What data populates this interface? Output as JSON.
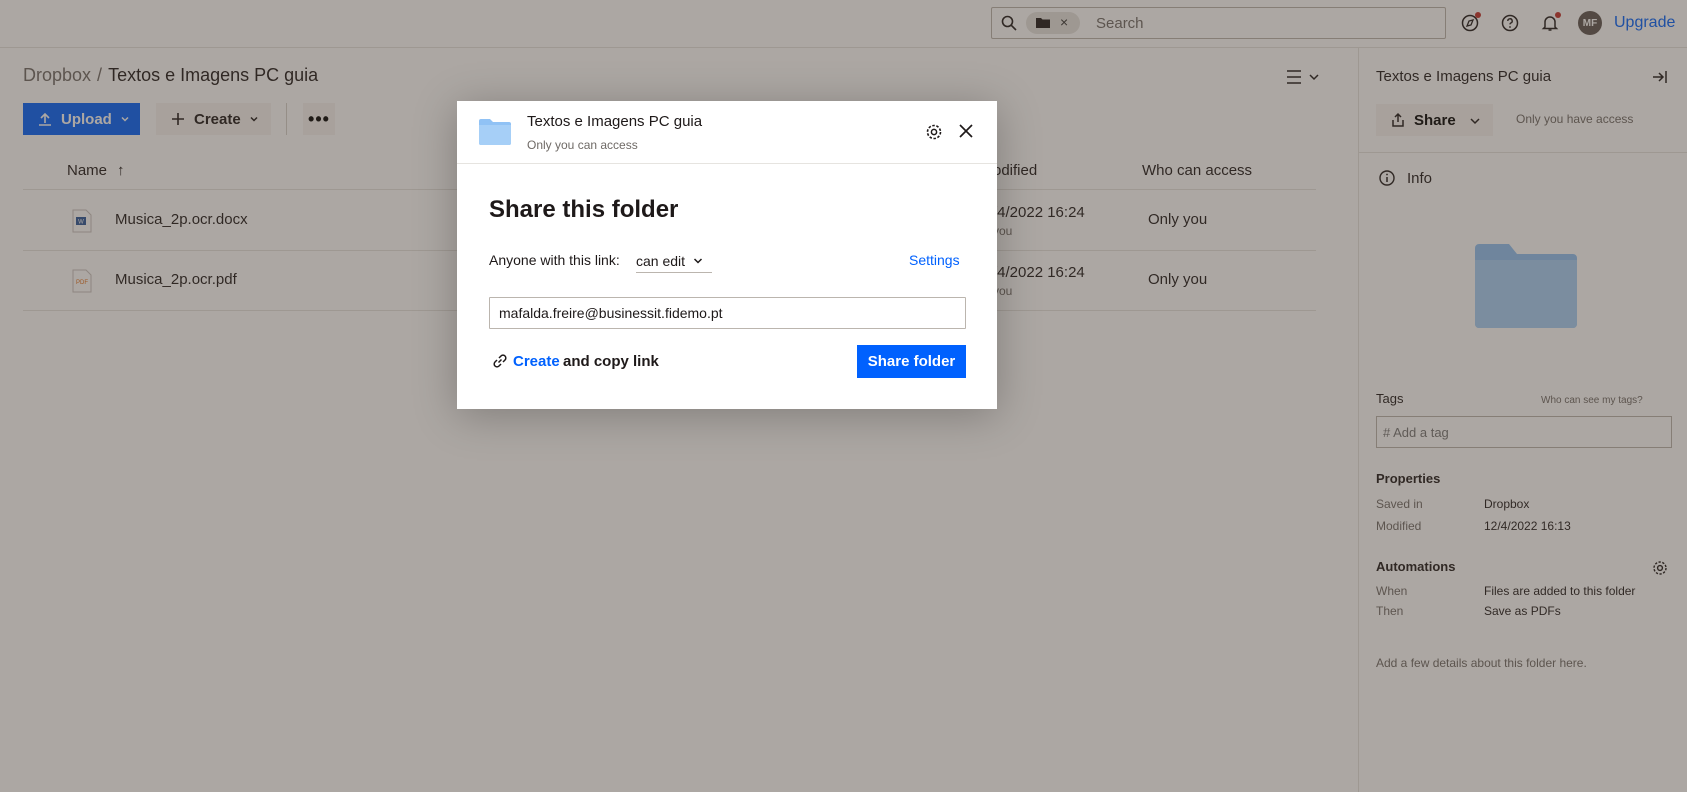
{
  "topbar": {
    "search_placeholder": "Search",
    "chip_close": "×",
    "avatar_initials": "MF",
    "upgrade_label": "Upgrade"
  },
  "breadcrumb": {
    "root": "Dropbox",
    "separator": "/",
    "current": "Textos e Imagens PC guia"
  },
  "toolbar": {
    "upload_label": "Upload",
    "create_label": "Create",
    "more_label": "•••"
  },
  "table": {
    "columns": {
      "name": "Name",
      "sort_arrow": "↑",
      "modified": "odified",
      "access": "Who can access"
    },
    "rows": [
      {
        "name": "Musica_2p.ocr.docx",
        "modified": "/4/2022 16:24",
        "by": "you",
        "access": "Only you",
        "file_type": "word"
      },
      {
        "name": "Musica_2p.ocr.pdf",
        "modified": "/4/2022 16:24",
        "by": "you",
        "access": "Only you",
        "file_type": "pdf"
      }
    ]
  },
  "right_panel": {
    "title": "Textos e Imagens PC guia",
    "share_label": "Share",
    "access_text": "Only you have access",
    "info_label": "Info",
    "tags_label": "Tags",
    "tags_help": "Who can see my tags?",
    "tag_placeholder": "# Add a tag",
    "properties_label": "Properties",
    "saved_in_label": "Saved in",
    "saved_in_value": "Dropbox",
    "modified_label": "Modified",
    "modified_value": "12/4/2022 16:13",
    "automations_label": "Automations",
    "when_label": "When",
    "when_value": "Files are added to this folder",
    "then_label": "Then",
    "then_value": "Save as PDFs",
    "details_text": "Add a few details about this folder here."
  },
  "modal": {
    "folder_name": "Textos e Imagens PC guia",
    "folder_access": "Only you can access",
    "heading": "Share this folder",
    "anyone_label": "Anyone with this link:",
    "permission": "can edit",
    "settings_label": "Settings",
    "email_value": "mafalda.freire@businessit.fidemo.pt",
    "create_link": "Create",
    "copy_link_text": "and copy link",
    "share_button": "Share folder"
  },
  "colors": {
    "accent": "#0061fe",
    "folder": "#90c2f5",
    "overlay": "#7f766e"
  }
}
